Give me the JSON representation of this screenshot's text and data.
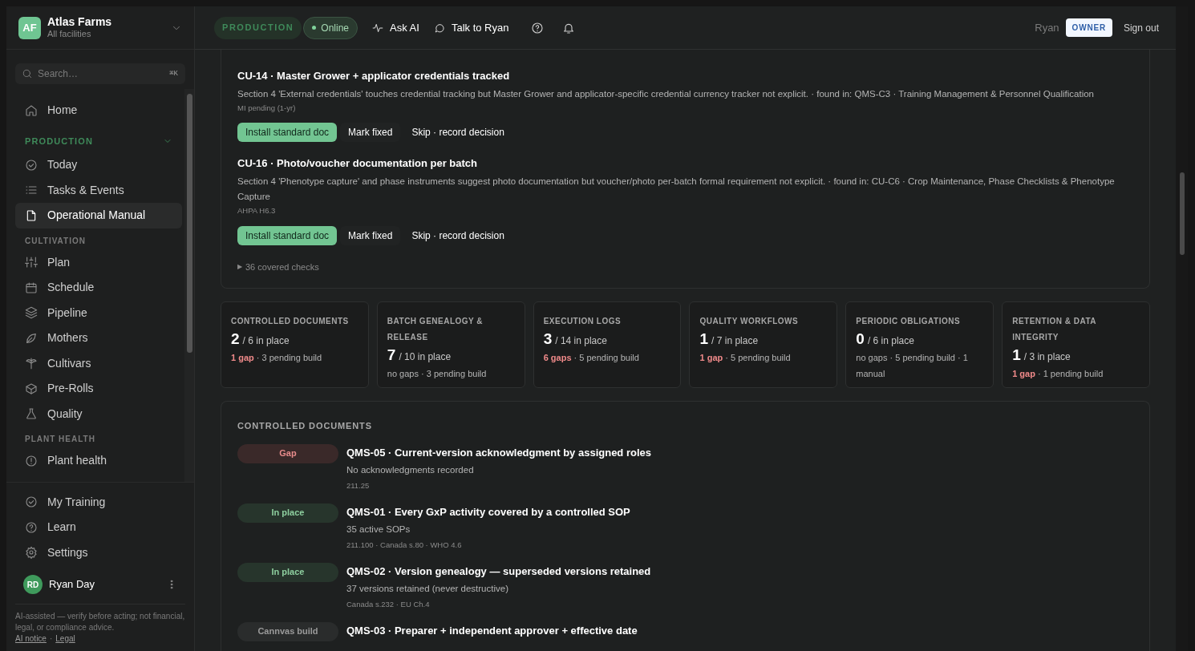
{
  "sidebar": {
    "org": {
      "initials": "AF",
      "name": "Atlas Farms",
      "subtitle": "All facilities"
    },
    "search": {
      "placeholder": "Search…",
      "shortcut": "⌘K"
    },
    "sections": [
      {
        "items": [
          {
            "label": "Home",
            "selected": false
          }
        ]
      },
      {
        "heading": "PRODUCTION",
        "expanded": true,
        "items": [
          {
            "label": "Today",
            "selected": false
          },
          {
            "label": "Tasks & Events",
            "selected": false
          },
          {
            "label": "Operational Manual",
            "selected": true
          }
        ]
      },
      {
        "heading": "CULTIVATION",
        "items": [
          {
            "label": "Plan",
            "selected": false
          },
          {
            "label": "Schedule",
            "selected": false
          },
          {
            "label": "Pipeline",
            "selected": false
          },
          {
            "label": "Mothers",
            "selected": false
          },
          {
            "label": "Cultivars",
            "selected": false
          },
          {
            "label": "Pre-Rolls",
            "selected": false
          },
          {
            "label": "Quality",
            "selected": false
          }
        ]
      },
      {
        "heading": "PLANT HEALTH",
        "items": [
          {
            "label": "Plant health",
            "selected": false
          }
        ]
      }
    ],
    "footer_items": [
      {
        "label": "My Training",
        "selected": false
      },
      {
        "label": "Learn",
        "selected": false
      },
      {
        "label": "Settings",
        "selected": false
      }
    ],
    "user": {
      "initials": "RD",
      "name": "Ryan Day"
    },
    "disclaimer": "AI-assisted — verify before acting; not financial, legal, or compliance advice.",
    "links": [
      "AI notice",
      "Legal"
    ],
    "link_separator": "·"
  },
  "topbar": {
    "mode": "PRODUCTION",
    "status": "Online",
    "actions": [
      "Ask AI",
      "Talk to Ryan"
    ],
    "user_name": "Ryan",
    "role": "OWNER",
    "sign_out": "Sign out"
  },
  "findings": {
    "items": [
      {
        "title": "CU-14 · Master Grower + applicator credentials tracked",
        "description": "Section 4 'External credentials' touches credential tracking but Master Grower and applicator-specific credential currency tracker not explicit. · found in: QMS-C3 · Training Management & Personnel Qualification",
        "reference": "MI pending (1-yr)",
        "actions": [
          "Install standard doc",
          "Mark fixed",
          "Skip · record decision"
        ]
      },
      {
        "title": "CU-16 · Photo/voucher documentation per batch",
        "description": "Section 4 'Phenotype capture' and phase instruments suggest photo documentation but voucher/photo per-batch formal requirement not explicit. · found in: CU-C6 · Crop Maintenance, Phase Checklists & Phenotype Capture",
        "reference": "AHPA H6.3",
        "actions": [
          "Install standard doc",
          "Mark fixed",
          "Skip · record decision"
        ]
      }
    ],
    "covered_toggle": "▶",
    "covered": "36 covered checks",
    "expanded": false
  },
  "summary": [
    {
      "title": "CONTROLLED DOCUMENTS",
      "count": "2",
      "total": "/ 6 in place",
      "gaps": "1 gap",
      "gap_alert": true,
      "detail": "· 3 pending build"
    },
    {
      "title": "BATCH GENEALOGY & RELEASE",
      "count": "7",
      "total": "/ 10 in place",
      "gaps": "no gaps",
      "gap_alert": false,
      "detail": "· 3 pending build"
    },
    {
      "title": "EXECUTION LOGS",
      "count": "3",
      "total": "/ 14 in place",
      "gaps": "6 gaps",
      "gap_alert": true,
      "detail": "· 5 pending build"
    },
    {
      "title": "QUALITY WORKFLOWS",
      "count": "1",
      "total": "/ 7 in place",
      "gaps": "1 gap",
      "gap_alert": true,
      "detail": "· 5 pending build"
    },
    {
      "title": "PERIODIC OBLIGATIONS",
      "count": "0",
      "total": "/ 6 in place",
      "gaps": "no gaps",
      "gap_alert": false,
      "detail": "· 5 pending build · 1 manual"
    },
    {
      "title": "RETENTION & DATA INTEGRITY",
      "count": "1",
      "total": "/ 3 in place",
      "gaps": "1 gap",
      "gap_alert": true,
      "detail": "· 1 pending build"
    }
  ],
  "documents": {
    "heading": "CONTROLLED DOCUMENTS",
    "items": [
      {
        "status": "Gap",
        "kind": "gap",
        "title": "QMS-05 · Current-version acknowledgment by assigned roles",
        "note": "No acknowledgments recorded",
        "refs": "211.25"
      },
      {
        "status": "In place",
        "kind": "in_place",
        "title": "QMS-01 · Every GxP activity covered by a controlled SOP",
        "note": "35 active SOPs",
        "refs": "211.100 · Canada s.80 · WHO 4.6"
      },
      {
        "status": "In place",
        "kind": "in_place",
        "title": "QMS-02 · Version genealogy — superseded versions retained",
        "note": "37 versions retained (never destructive)",
        "refs": "Canada s.232 · EU Ch.4"
      },
      {
        "status": "Cannvas build",
        "kind": "build",
        "title": "QMS-03 · Preparer + independent approver + effective date"
      }
    ]
  }
}
